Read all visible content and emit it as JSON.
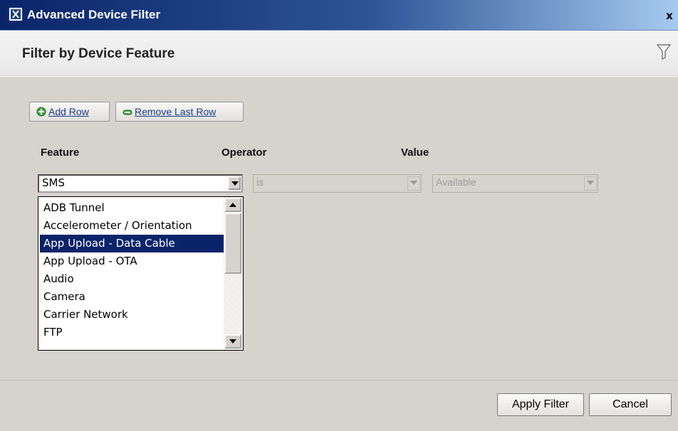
{
  "window": {
    "title": "Advanced Device Filter",
    "close_label": "x"
  },
  "header": {
    "title": "Filter by Device Feature"
  },
  "toolbar": {
    "add_row_label": "Add Row",
    "remove_row_label": "Remove Last Row"
  },
  "columns": {
    "feature": "Feature",
    "operator": "Operator",
    "value": "Value"
  },
  "filter_row": {
    "feature": "SMS",
    "operator": "is",
    "value": "Available"
  },
  "feature_options": [
    "ADB Tunnel",
    "Accelerometer / Orientation",
    "App Upload - Data Cable",
    "App Upload - OTA",
    "Audio",
    "Camera",
    "Carrier Network",
    "FTP"
  ],
  "highlighted_option": "App Upload - Data Cable",
  "footer": {
    "apply_label": "Apply Filter",
    "cancel_label": "Cancel"
  },
  "colors": {
    "titlebar": "#0a246a",
    "selection": "#0a246a",
    "dialog_bg": "#d6d3ce",
    "link": "#1a3c8a",
    "add_icon": "#2e8b2e"
  },
  "icons": [
    "app-logo-icon",
    "close-icon",
    "funnel-icon",
    "add-icon",
    "remove-icon",
    "dropdown-arrow-icon",
    "scroll-up-icon",
    "scroll-down-icon"
  ]
}
